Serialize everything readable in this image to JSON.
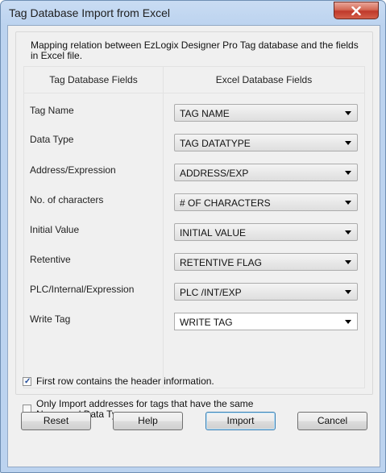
{
  "window": {
    "title": "Tag Database Import from Excel"
  },
  "description": "Mapping relation between EzLogix Designer Pro Tag database and the fields in Excel file.",
  "table": {
    "left_header": "Tag Database Fields",
    "right_header": "Excel Database Fields",
    "rows": [
      {
        "label": "Tag Name",
        "value": "TAG NAME"
      },
      {
        "label": "Data Type",
        "value": "TAG DATATYPE"
      },
      {
        "label": "Address/Expression",
        "value": "ADDRESS/EXP"
      },
      {
        "label": "No. of characters",
        "value": "# OF CHARACTERS"
      },
      {
        "label": "Initial Value",
        "value": "INITIAL VALUE"
      },
      {
        "label": "Retentive",
        "value": "RETENTIVE FLAG"
      },
      {
        "label": "PLC/Internal/Expression",
        "value": "PLC /INT/EXP"
      },
      {
        "label": "Write Tag",
        "value": "WRITE TAG"
      }
    ]
  },
  "options": {
    "header_row": {
      "label": "First row contains the header information.",
      "checked": true
    },
    "same_name_type": {
      "line1": "Only Import addresses for tags that have the same",
      "line2": "Name and Data Type",
      "checked": false
    }
  },
  "buttons": {
    "reset": "Reset",
    "help": "Help",
    "import": "Import",
    "cancel": "Cancel"
  },
  "icons": {
    "close": "close-x-icon",
    "dropdown": "chevron-down-icon",
    "check": "checkmark-icon"
  },
  "colors": {
    "titlebar": "#bcd3ef",
    "close_button": "#c0392b",
    "dialog_bg": "#f0f0f0",
    "default_button_border": "#3c7fb1"
  }
}
